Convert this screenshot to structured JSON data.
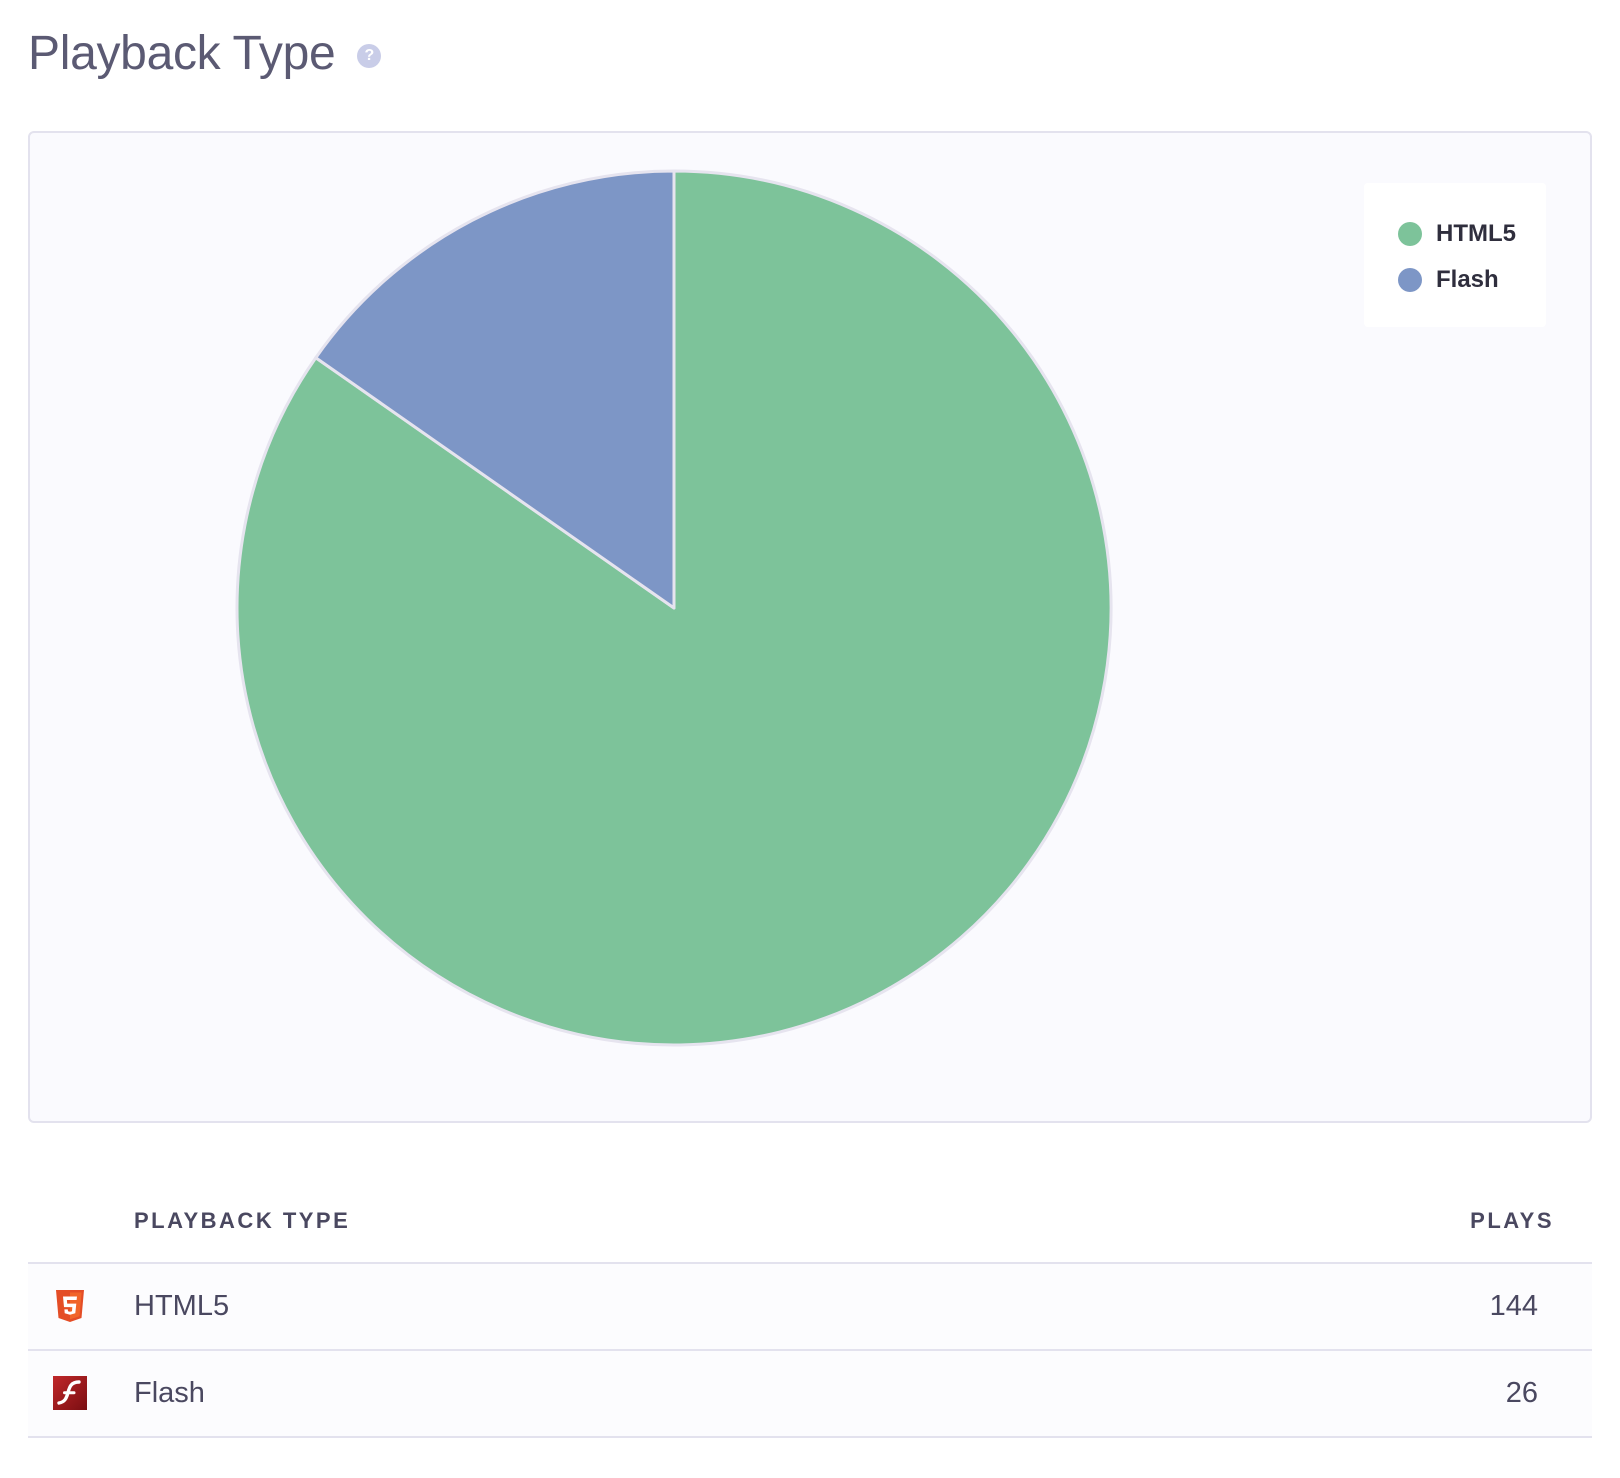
{
  "header": {
    "title": "Playback Type",
    "help_icon": "question-circle-icon",
    "help_glyph": "?"
  },
  "chart_data": {
    "type": "pie",
    "slices": [
      {
        "label": "HTML5",
        "value": 144,
        "color": "#7dc39a"
      },
      {
        "label": "Flash",
        "value": 26,
        "color": "#7d96c6"
      }
    ],
    "legend": {
      "placement": "top-right",
      "entries": [
        "HTML5",
        "Flash"
      ]
    },
    "colors": {
      "HTML5": "#7dc39a",
      "Flash": "#7d96c6",
      "slice_border": "#e6e4ef"
    }
  },
  "table": {
    "headers": {
      "type": "PLAYBACK TYPE",
      "plays": "PLAYS"
    },
    "rows": [
      {
        "icon": "html5-icon",
        "label": "HTML5",
        "plays": "144"
      },
      {
        "icon": "flash-icon",
        "label": "Flash",
        "plays": "26"
      }
    ]
  }
}
